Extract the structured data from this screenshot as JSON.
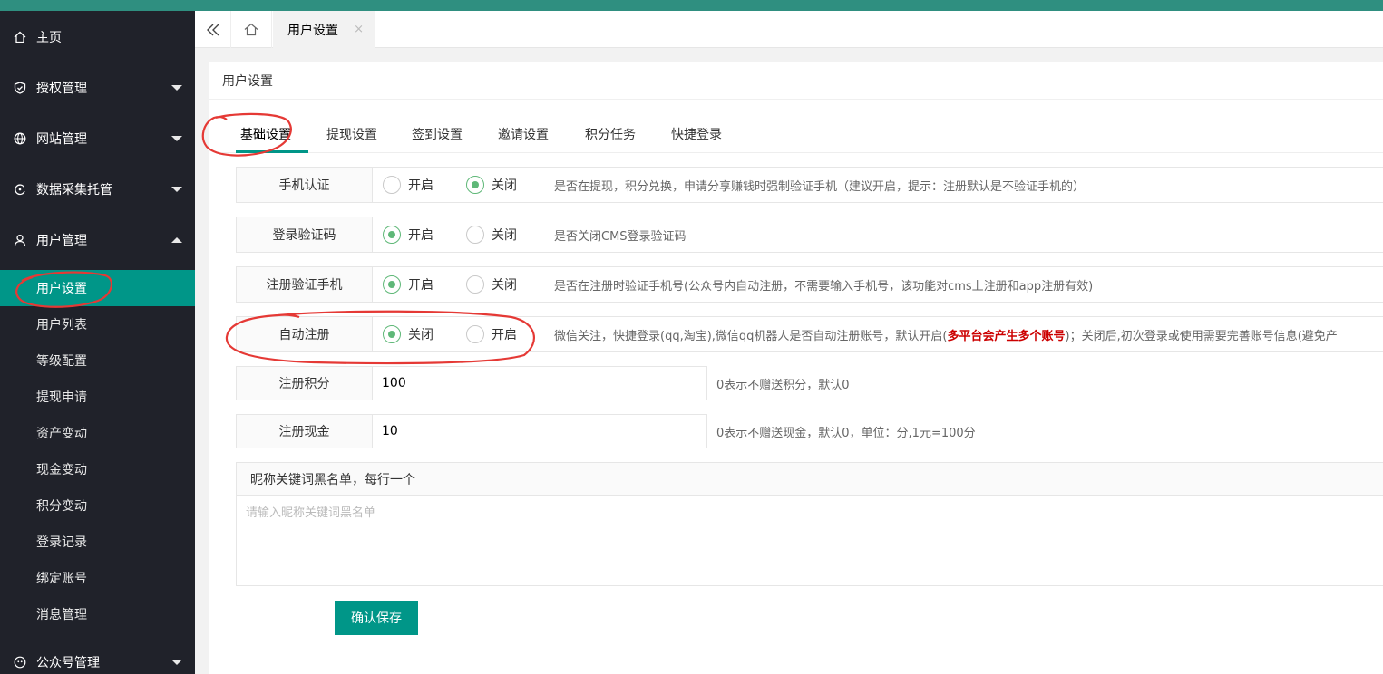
{
  "sidebar": {
    "items": [
      {
        "label": "主页",
        "icon": "home-icon"
      },
      {
        "label": "授权管理",
        "icon": "shield-icon"
      },
      {
        "label": "网站管理",
        "icon": "globe-icon"
      },
      {
        "label": "数据采集托管",
        "icon": "sync-icon"
      },
      {
        "label": "用户管理",
        "icon": "user-icon"
      }
    ],
    "submenu": [
      "用户设置",
      "用户列表",
      "等级配置",
      "提现申请",
      "资产变动",
      "现金变动",
      "积分变动",
      "登录记录",
      "绑定账号",
      "消息管理"
    ],
    "bottom_item": {
      "label": "公众号管理",
      "icon": "wechat-icon"
    }
  },
  "tabbar": {
    "current_tab": "用户设置",
    "close_glyph": "×"
  },
  "card": {
    "title": "用户设置"
  },
  "tabs": [
    "基础设置",
    "提现设置",
    "签到设置",
    "邀请设置",
    "积分任务",
    "快捷登录"
  ],
  "radio_rows": [
    {
      "label": "手机认证",
      "option1": "开启",
      "option2": "关闭",
      "selected": "option2",
      "tip": "是否在提现，积分兑换，申请分享赚钱时强制验证手机（建议开启，提示：注册默认是不验证手机的）"
    },
    {
      "label": "登录验证码",
      "option1": "开启",
      "option2": "关闭",
      "selected": "option1",
      "tip": "是否关闭CMS登录验证码"
    },
    {
      "label": "注册验证手机",
      "option1": "开启",
      "option2": "关闭",
      "selected": "option1",
      "tip": "是否在注册时验证手机号(公众号内自动注册，不需要输入手机号，该功能对cms上注册和app注册有效)"
    },
    {
      "label": "自动注册",
      "option1": "关闭",
      "option2": "开启",
      "selected": "option1",
      "tip": "微信关注，快捷登录(qq,淘宝),微信qq机器人是否自动注册账号，默认开启(",
      "tip_warn": "多平台会产生多个账号",
      "tip_after": ")；关闭后,初次登录或使用需要完善账号信息(避免产"
    }
  ],
  "input_rows": [
    {
      "label": "注册积分",
      "value": "100",
      "aux": "0表示不赠送积分，默认0"
    },
    {
      "label": "注册现金",
      "value": "10",
      "aux": "0表示不赠送现金，默认0，单位：分,1元=100分"
    }
  ],
  "blacklist": {
    "label": "昵称关键词黑名单，每行一个",
    "placeholder": "请输入昵称关键词黑名单"
  },
  "save_button": "确认保存",
  "colors": {
    "primary": "#009688",
    "sidebar_bg": "#20222a",
    "top_accent": "#2f8f80",
    "radio_checked": "#5fb878",
    "warn": "#cc0000",
    "annotation": "#e53935"
  }
}
